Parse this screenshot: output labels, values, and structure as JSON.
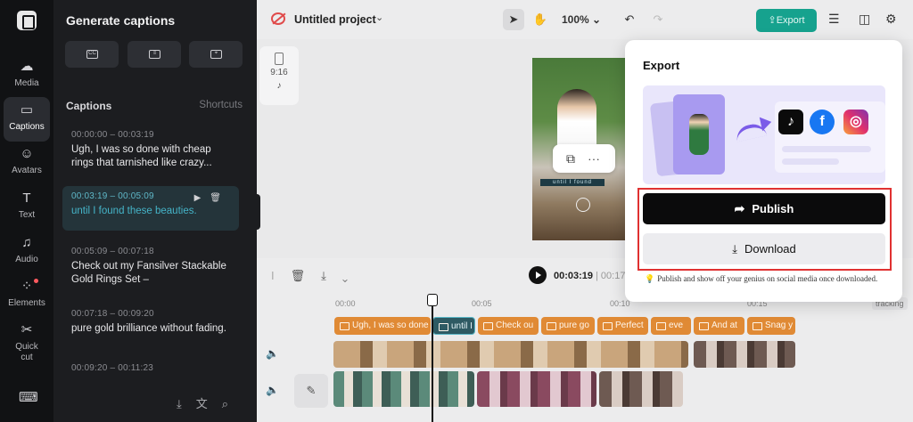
{
  "rail": {
    "items": [
      {
        "label": "Media",
        "icon": "cloud-upload-icon"
      },
      {
        "label": "Captions",
        "icon": "captions-icon"
      },
      {
        "label": "Avatars",
        "icon": "avatar-icon"
      },
      {
        "label": "Text",
        "icon": "text-icon"
      },
      {
        "label": "Audio",
        "icon": "audio-icon"
      },
      {
        "label": "Elements",
        "icon": "elements-icon"
      },
      {
        "label": "Quick cut",
        "icon": "quick-cut-icon"
      }
    ]
  },
  "panel": {
    "title": "Generate captions",
    "captions_heading": "Captions",
    "shortcuts": "Shortcuts",
    "captions": [
      {
        "time": "00:00:00 – 00:03:19",
        "text": "Ugh, I was so done with cheap rings that tarnished like crazy..."
      },
      {
        "time": "00:03:19 – 00:05:09",
        "text": "until I found these beauties."
      },
      {
        "time": "00:05:09 – 00:07:18",
        "text": "Check out my Fansilver Stackable Gold Rings Set –"
      },
      {
        "time": "00:07:18 – 00:09:20",
        "text": "pure gold brilliance without fading."
      },
      {
        "time": "00:09:20 – 00:11:23",
        "text": ""
      }
    ]
  },
  "topbar": {
    "project_name": "Untitled project",
    "zoom": "100%",
    "export_label": "Export"
  },
  "canvas": {
    "ratio": "9:16",
    "video_caption": "until I found"
  },
  "timeline": {
    "current_time": "00:03:19",
    "total_time": "| 00:17",
    "ruler": [
      "00:00",
      "00:05",
      "00:10",
      "00:15"
    ],
    "tracking": "tracking",
    "caption_clips": [
      "Ugh, I was so done",
      "until I fo",
      "Check ou",
      "pure go",
      "Perfect",
      "eve",
      "And at",
      "Snag y"
    ]
  },
  "export": {
    "title": "Export",
    "publish_label": "Publish",
    "download_label": "Download",
    "hint": "Publish and show off your genius on social media once downloaded."
  },
  "colors": {
    "accent": "#16a28e",
    "caption_clip": "#e08a35",
    "highlight_box": "#e03131"
  }
}
